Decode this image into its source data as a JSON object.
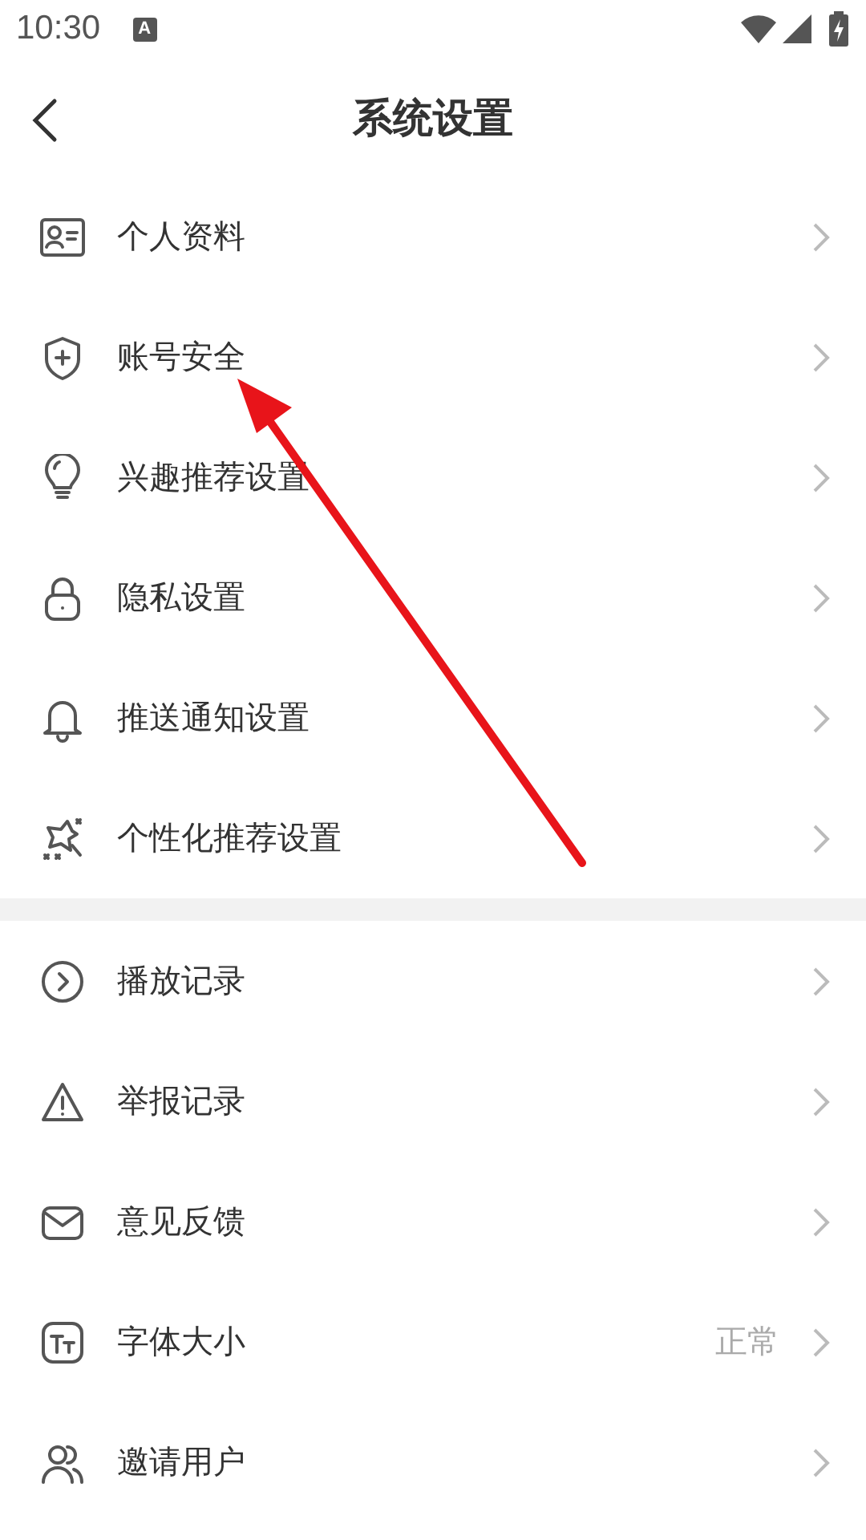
{
  "status_bar": {
    "time": "10:30",
    "notification_icon_letter": "A"
  },
  "header": {
    "title": "系统设置"
  },
  "sections": [
    {
      "items": [
        {
          "label": "个人资料"
        },
        {
          "label": "账号安全"
        },
        {
          "label": "兴趣推荐设置"
        },
        {
          "label": "隐私设置"
        },
        {
          "label": "推送通知设置"
        },
        {
          "label": "个性化推荐设置"
        }
      ]
    },
    {
      "items": [
        {
          "label": "播放记录"
        },
        {
          "label": "举报记录"
        },
        {
          "label": "意见反馈"
        },
        {
          "label": "字体大小",
          "value": "正常"
        },
        {
          "label": "邀请用户"
        }
      ]
    }
  ]
}
